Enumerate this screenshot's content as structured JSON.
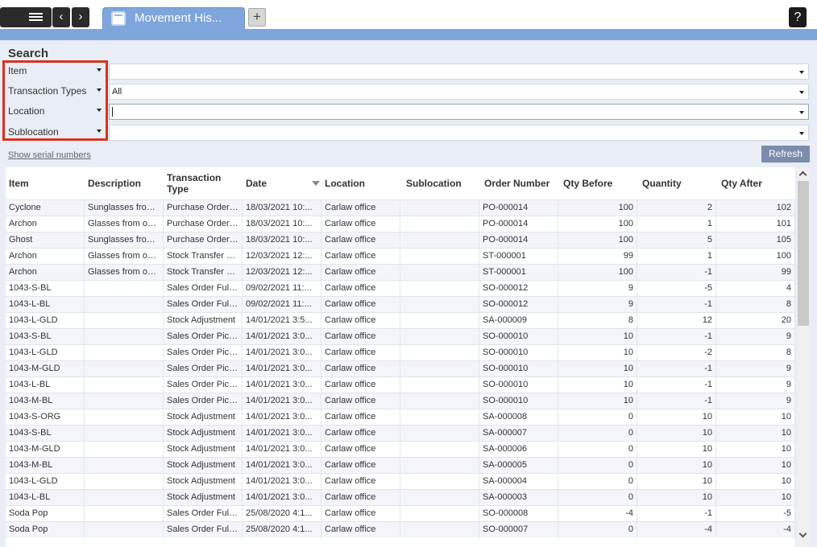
{
  "topbar": {
    "menu_icon": "hamburger-icon",
    "back_icon": "chevron-left-icon",
    "back_glyph": "‹",
    "forward_icon": "chevron-right-icon",
    "forward_glyph": "›",
    "tab_label": "Movement His...",
    "tab_icon": "window-icon",
    "add_tab_glyph": "+",
    "help_glyph": "?"
  },
  "search": {
    "title": "Search",
    "filters": [
      {
        "label": "Item",
        "value": ""
      },
      {
        "label": "Transaction Types",
        "value": "All"
      },
      {
        "label": "Location",
        "value": ""
      },
      {
        "label": "Sublocation",
        "value": ""
      }
    ],
    "serial_link": "Show serial numbers",
    "refresh_label": "Refresh"
  },
  "colors": {
    "accent": "#7ea6dc",
    "highlight": "#d9321f",
    "refresh": "#7c8cab"
  },
  "grid": {
    "columns": [
      "Item",
      "Description",
      "Transaction Type",
      "Date",
      "Location",
      "Sublocation",
      "Order Number",
      "Qty Before",
      "Quantity",
      "Qty After"
    ],
    "rows": [
      [
        "Cyclone",
        "Sunglasses from ...",
        "Purchase Order ...",
        "18/03/2021 10:...",
        "Carlaw office",
        "",
        "PO-000014",
        "100",
        "2",
        "102"
      ],
      [
        "Archon",
        "Glasses from our ...",
        "Purchase Order ...",
        "18/03/2021 10:...",
        "Carlaw office",
        "",
        "PO-000014",
        "100",
        "1",
        "101"
      ],
      [
        "Ghost",
        "Sunglasses from ...",
        "Purchase Order ...",
        "18/03/2021 10:...",
        "Carlaw office",
        "",
        "PO-000014",
        "100",
        "5",
        "105"
      ],
      [
        "Archon",
        "Glasses from our ...",
        "Stock Transfer R...",
        "12/03/2021 12:...",
        "Carlaw office",
        "",
        "ST-000001",
        "99",
        "1",
        "100"
      ],
      [
        "Archon",
        "Glasses from our ...",
        "Stock Transfer S...",
        "12/03/2021 12:...",
        "Carlaw office",
        "",
        "ST-000001",
        "100",
        "-1",
        "99"
      ],
      [
        "1043-S-BL",
        "",
        "Sales Order Fulfill...",
        "09/02/2021 11:...",
        "Carlaw office",
        "",
        "SO-000012",
        "9",
        "-5",
        "4"
      ],
      [
        "1043-L-BL",
        "",
        "Sales Order Fulfill...",
        "09/02/2021 11:...",
        "Carlaw office",
        "",
        "SO-000012",
        "9",
        "-1",
        "8"
      ],
      [
        "1043-L-GLD",
        "",
        "Stock Adjustment",
        "14/01/2021 3:5...",
        "Carlaw office",
        "",
        "SA-000009",
        "8",
        "12",
        "20"
      ],
      [
        "1043-S-BL",
        "",
        "Sales Order Picki...",
        "14/01/2021 3:0...",
        "Carlaw office",
        "",
        "SO-000010",
        "10",
        "-1",
        "9"
      ],
      [
        "1043-L-GLD",
        "",
        "Sales Order Picki...",
        "14/01/2021 3:0...",
        "Carlaw office",
        "",
        "SO-000010",
        "10",
        "-2",
        "8"
      ],
      [
        "1043-M-GLD",
        "",
        "Sales Order Picki...",
        "14/01/2021 3:0...",
        "Carlaw office",
        "",
        "SO-000010",
        "10",
        "-1",
        "9"
      ],
      [
        "1043-L-BL",
        "",
        "Sales Order Picki...",
        "14/01/2021 3:0...",
        "Carlaw office",
        "",
        "SO-000010",
        "10",
        "-1",
        "9"
      ],
      [
        "1043-M-BL",
        "",
        "Sales Order Picki...",
        "14/01/2021 3:0...",
        "Carlaw office",
        "",
        "SO-000010",
        "10",
        "-1",
        "9"
      ],
      [
        "1043-S-ORG",
        "",
        "Stock Adjustment",
        "14/01/2021 3:0...",
        "Carlaw office",
        "",
        "SA-000008",
        "0",
        "10",
        "10"
      ],
      [
        "1043-S-BL",
        "",
        "Stock Adjustment",
        "14/01/2021 3:0...",
        "Carlaw office",
        "",
        "SA-000007",
        "0",
        "10",
        "10"
      ],
      [
        "1043-M-GLD",
        "",
        "Stock Adjustment",
        "14/01/2021 3:0...",
        "Carlaw office",
        "",
        "SA-000006",
        "0",
        "10",
        "10"
      ],
      [
        "1043-M-BL",
        "",
        "Stock Adjustment",
        "14/01/2021 3:0...",
        "Carlaw office",
        "",
        "SA-000005",
        "0",
        "10",
        "10"
      ],
      [
        "1043-L-GLD",
        "",
        "Stock Adjustment",
        "14/01/2021 3:0...",
        "Carlaw office",
        "",
        "SA-000004",
        "0",
        "10",
        "10"
      ],
      [
        "1043-L-BL",
        "",
        "Stock Adjustment",
        "14/01/2021 3:0...",
        "Carlaw office",
        "",
        "SA-000003",
        "0",
        "10",
        "10"
      ],
      [
        "Soda Pop",
        "",
        "Sales Order Fulfill...",
        "25/08/2020 4:1...",
        "Carlaw office",
        "",
        "SO-000008",
        "-4",
        "-1",
        "-5"
      ],
      [
        "Soda Pop",
        "",
        "Sales Order Fulfill...",
        "25/08/2020 4:1...",
        "Carlaw office",
        "",
        "SO-000007",
        "0",
        "-4",
        "-4"
      ]
    ]
  }
}
